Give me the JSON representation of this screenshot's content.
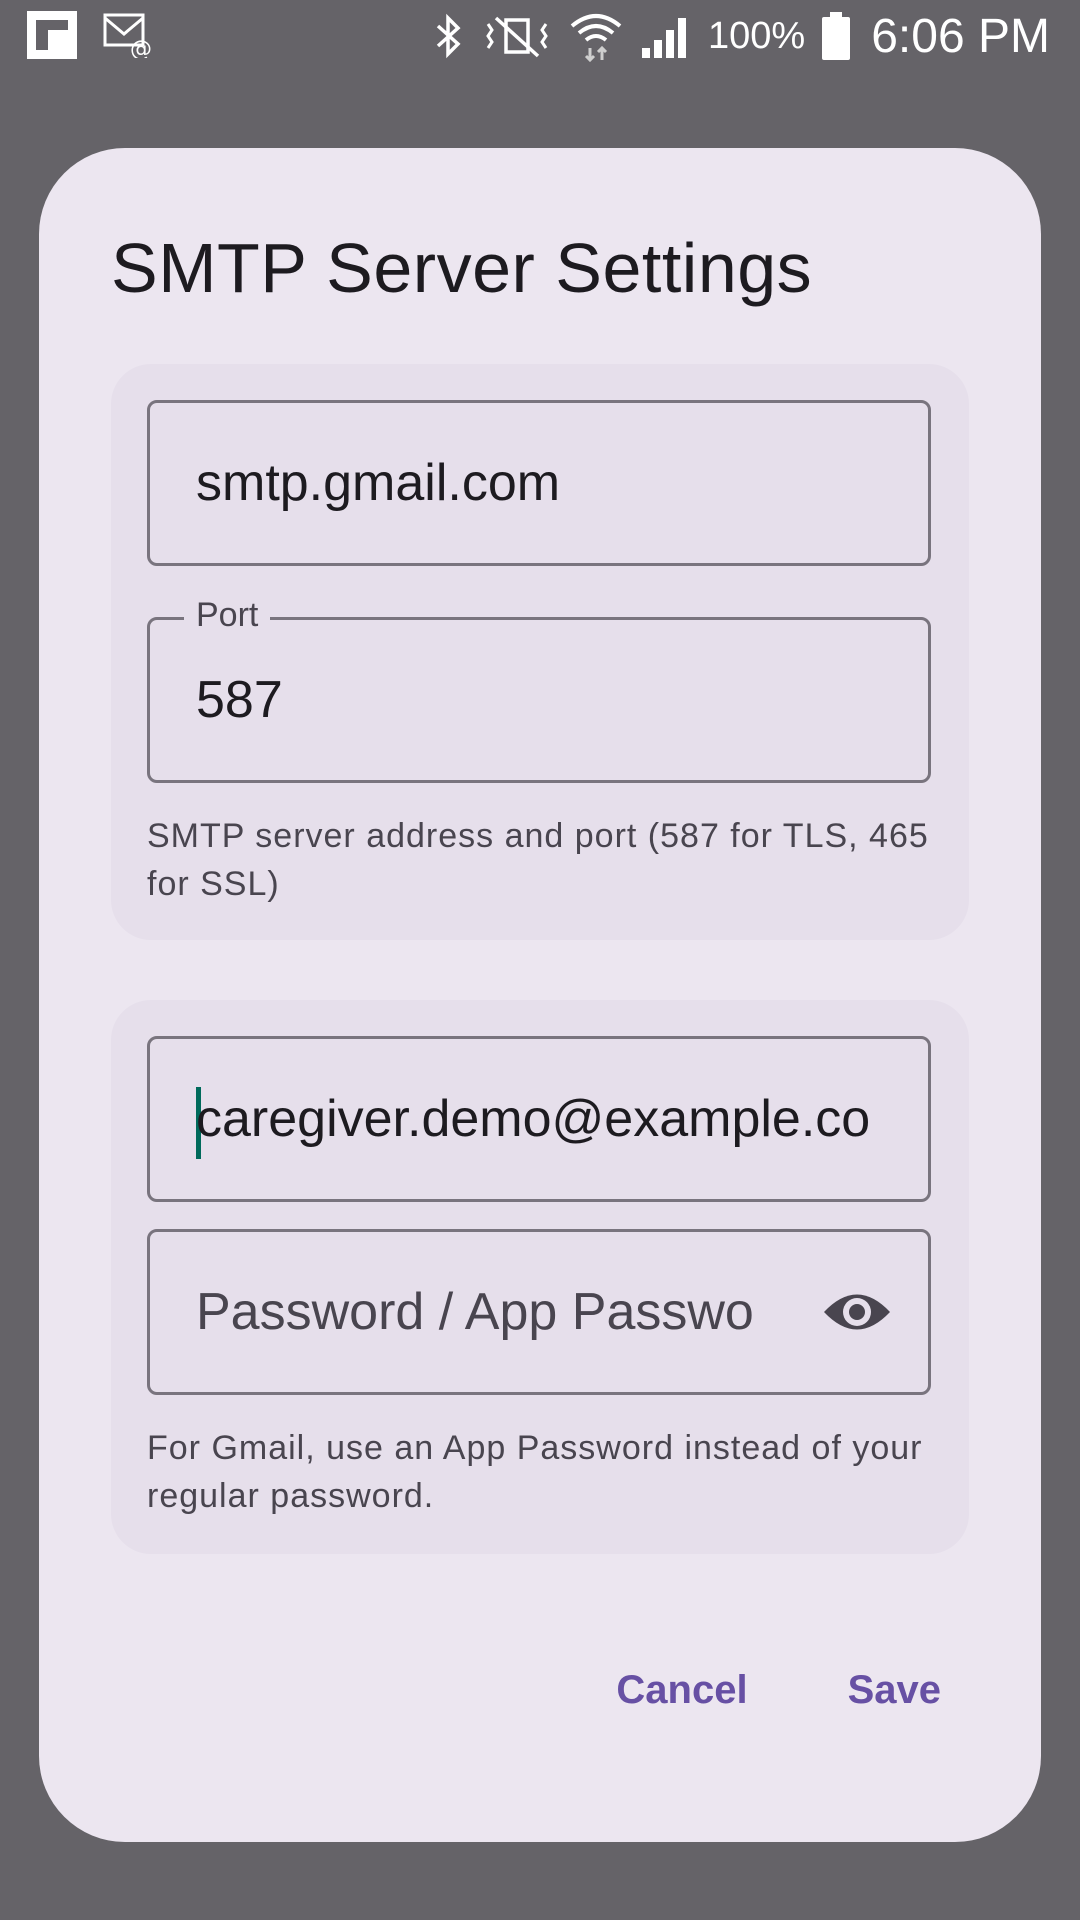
{
  "status_bar": {
    "battery": "100%",
    "time": "6:06 PM"
  },
  "dialog": {
    "title": "SMTP Server Settings",
    "server_card": {
      "server_value": "smtp.gmail.com",
      "port_label": "Port",
      "port_value": "587",
      "help": "SMTP server address and port (587 for TLS, 465 for SSL)"
    },
    "auth_card": {
      "email_value": "caregiver.demo@example.co",
      "password_placeholder": "Password / App Password",
      "help": "For Gmail, use an App Password instead of your regular password."
    },
    "actions": {
      "cancel": "Cancel",
      "save": "Save"
    }
  },
  "colors": {
    "scrim": "#656368",
    "dialog_bg": "#ece6f0",
    "card_bg": "#e6dfeb",
    "accent": "#6750a4",
    "caret": "#006a5b"
  }
}
